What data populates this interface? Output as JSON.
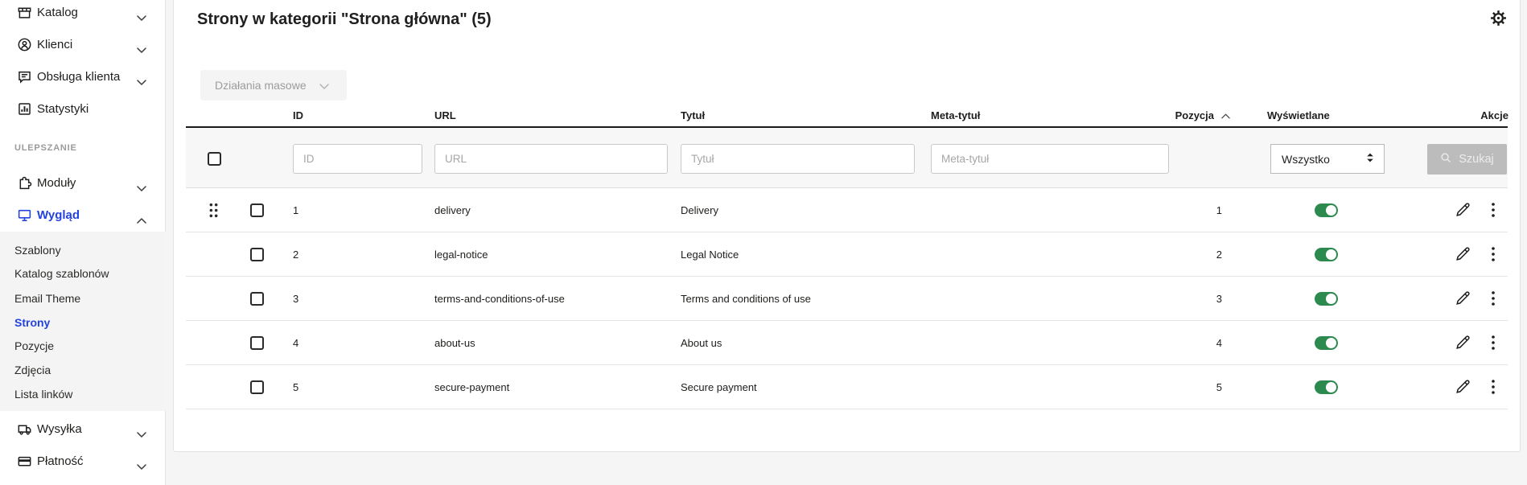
{
  "header": {
    "title": "Strony w kategorii \"Strona główna\" (5)"
  },
  "sidebar": {
    "items": [
      {
        "label": "Katalog"
      },
      {
        "label": "Klienci"
      },
      {
        "label": "Obsługa klienta"
      },
      {
        "label": "Statystyki"
      },
      {
        "label": "Moduły"
      },
      {
        "label": "Wygląd"
      },
      {
        "label": "Wysyłka"
      },
      {
        "label": "Płatność"
      }
    ],
    "section_label": "ULEPSZANIE",
    "submenu": {
      "items": [
        {
          "label": "Szablony"
        },
        {
          "label": "Katalog szablonów"
        },
        {
          "label": "Email Theme"
        },
        {
          "label": "Strony"
        },
        {
          "label": "Pozycje"
        },
        {
          "label": "Zdjęcia"
        },
        {
          "label": "Lista linków"
        }
      ],
      "active": "Strony"
    }
  },
  "toolbar": {
    "bulk_actions_label": "Działania masowe"
  },
  "table": {
    "headers": {
      "id": "ID",
      "url": "URL",
      "title": "Tytuł",
      "meta_title": "Meta-tytuł",
      "position": "Pozycja",
      "displayed": "Wyświetlane",
      "actions": "Akcje"
    },
    "filters": {
      "id_placeholder": "ID",
      "url_placeholder": "URL",
      "title_placeholder": "Tytuł",
      "meta_placeholder": "Meta-tytuł",
      "displayed_selected": "Wszystko",
      "search_label": "Szukaj"
    },
    "rows": [
      {
        "id": "1",
        "url": "delivery",
        "title": "Delivery",
        "meta_title": "",
        "position": "1",
        "displayed": true
      },
      {
        "id": "2",
        "url": "legal-notice",
        "title": "Legal Notice",
        "meta_title": "",
        "position": "2",
        "displayed": true
      },
      {
        "id": "3",
        "url": "terms-and-conditions-of-use",
        "title": "Terms and conditions of use",
        "meta_title": "",
        "position": "3",
        "displayed": true
      },
      {
        "id": "4",
        "url": "about-us",
        "title": "About us",
        "meta_title": "",
        "position": "4",
        "displayed": true
      },
      {
        "id": "5",
        "url": "secure-payment",
        "title": "Secure payment",
        "meta_title": "",
        "position": "5",
        "displayed": true
      }
    ]
  },
  "colors": {
    "accent_blue": "#2342e0",
    "toggle_green": "#2d8a4e"
  }
}
